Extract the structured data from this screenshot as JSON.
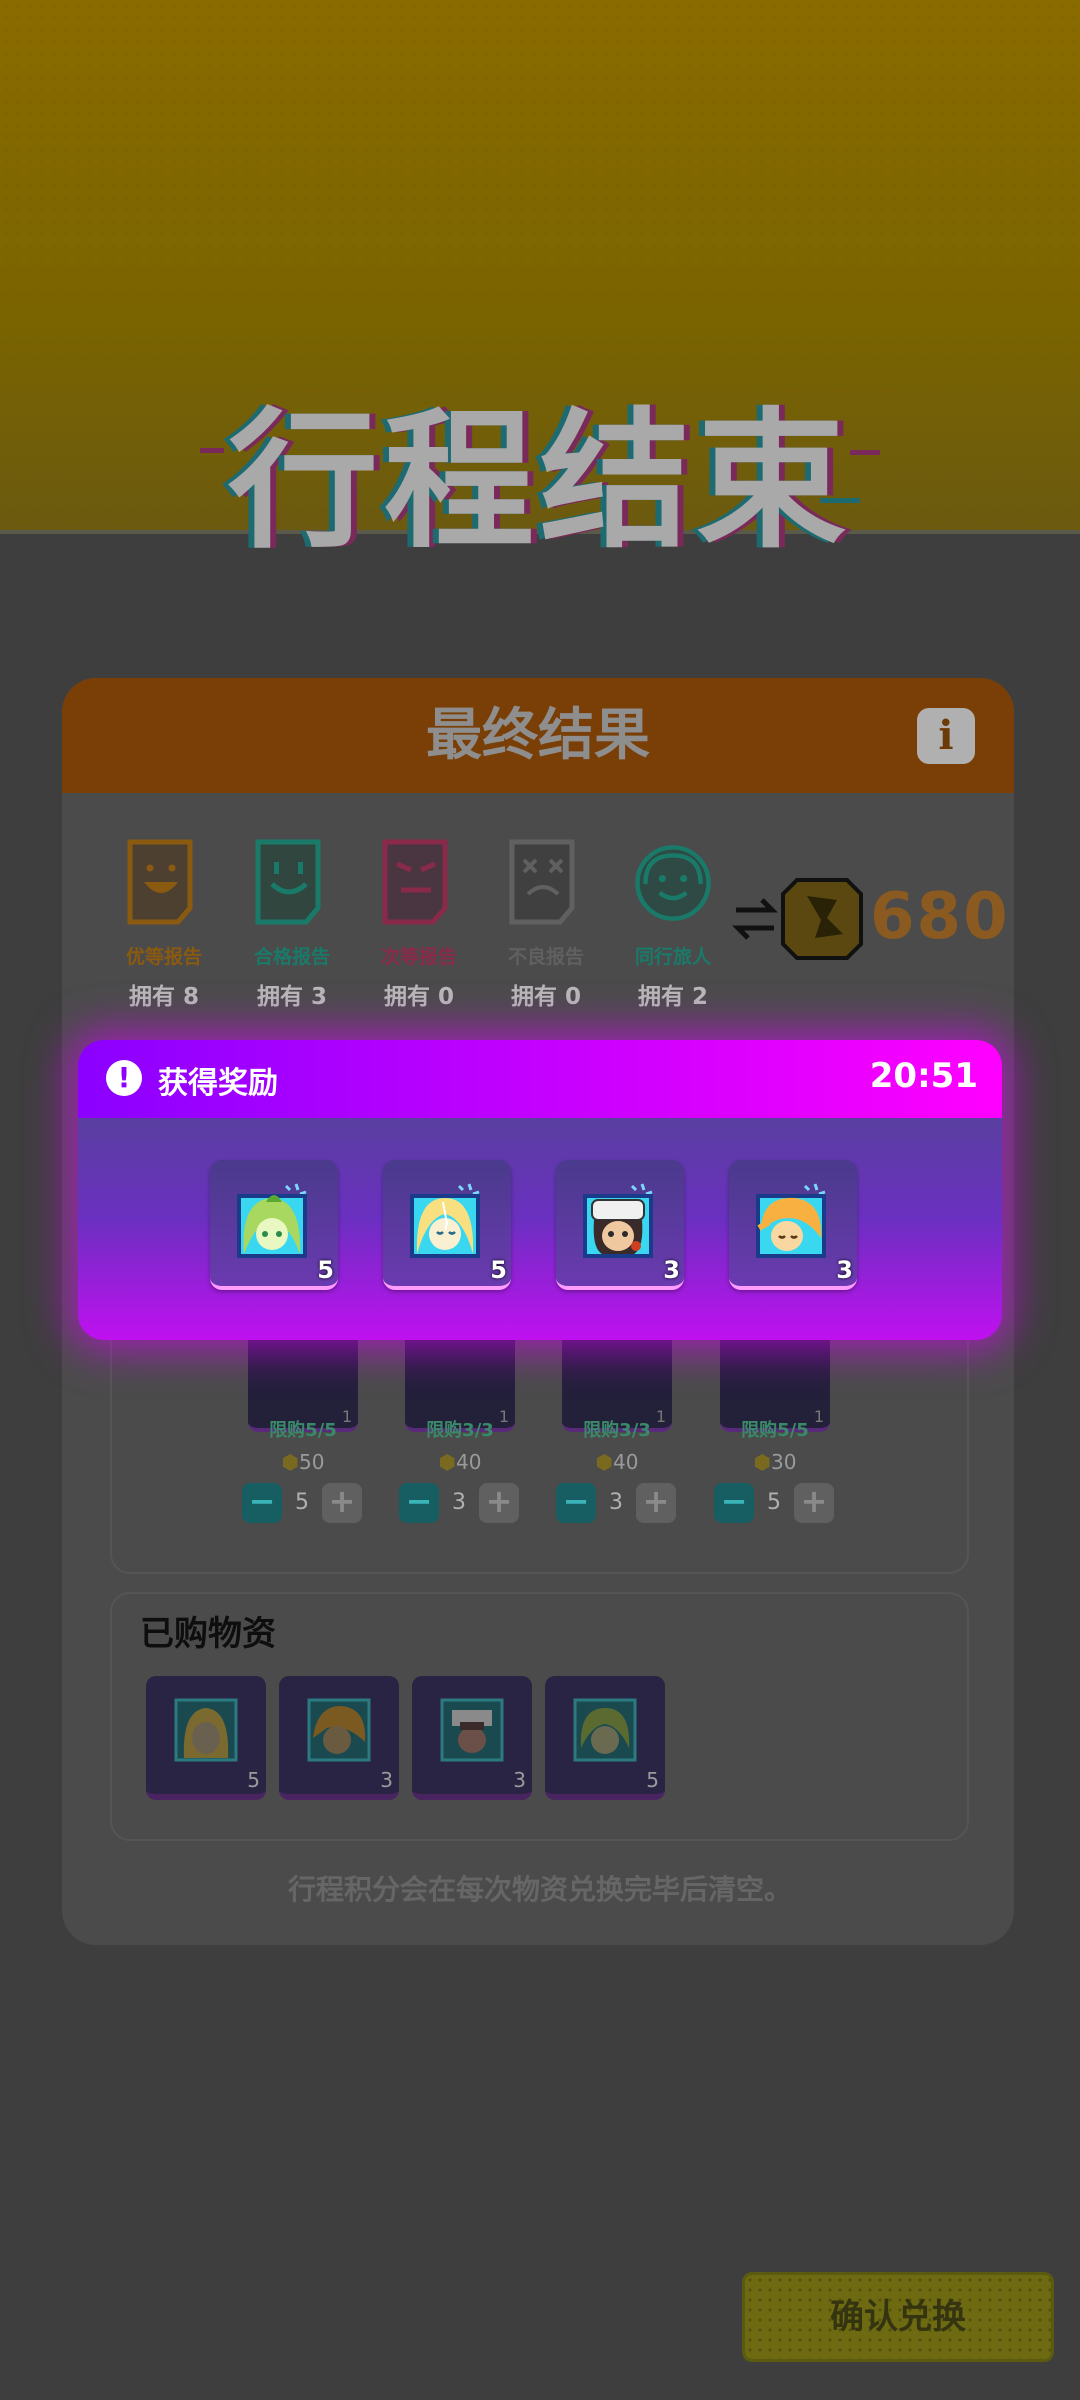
{
  "banner": {
    "title": "行程结束"
  },
  "result_panel": {
    "title": "最终结果",
    "info_icon": "i",
    "reports": [
      {
        "name": "优等报告",
        "owned": "拥有 8",
        "color": "#8a5a10",
        "icon": "happy-report-icon"
      },
      {
        "name": "合格报告",
        "owned": "拥有 3",
        "color": "#1a7a6a",
        "icon": "smile-report-icon"
      },
      {
        "name": "次等报告",
        "owned": "拥有 0",
        "color": "#8a2a4a",
        "icon": "annoyed-report-icon"
      },
      {
        "name": "不良报告",
        "owned": "拥有 0",
        "color": "#606060",
        "icon": "dizzy-report-icon"
      },
      {
        "name": "同行旅人",
        "owned": "拥有 2",
        "color": "#1a7a6a",
        "icon": "headset-traveler-icon"
      }
    ],
    "points": "680"
  },
  "shop": {
    "items": [
      {
        "limit": "限购5/5",
        "price": "50",
        "qty": "5",
        "stack": "1"
      },
      {
        "limit": "限购3/3",
        "price": "40",
        "qty": "3",
        "stack": "1"
      },
      {
        "limit": "限购3/3",
        "price": "40",
        "qty": "3",
        "stack": "1"
      },
      {
        "limit": "限购5/5",
        "price": "30",
        "qty": "5",
        "stack": "1"
      }
    ],
    "minus": "−",
    "plus": "+"
  },
  "purchased": {
    "title": "已购物资",
    "items": [
      {
        "count": "5",
        "hair": "#e8d070"
      },
      {
        "count": "3",
        "hair": "#e8a030"
      },
      {
        "count": "3",
        "hair": "#f0f0f0"
      },
      {
        "count": "5",
        "hair": "#90c860"
      }
    ]
  },
  "footer_note": "行程积分会在每次物资兑换完毕后清空。",
  "confirm_button": "确认兑换",
  "reward_modal": {
    "title": "获得奖励",
    "time": "20:51",
    "alert_icon": "!",
    "items": [
      {
        "count": "5",
        "hair": "#a8d860",
        "skin": "#e8f8c0"
      },
      {
        "count": "5",
        "hair": "#f8e080",
        "skin": "#f8f0d0"
      },
      {
        "count": "3",
        "hair": "#f0f0f0",
        "skin": "#f0c8a0"
      },
      {
        "count": "3",
        "hair": "#f8b040",
        "skin": "#f8d8a0"
      }
    ]
  }
}
